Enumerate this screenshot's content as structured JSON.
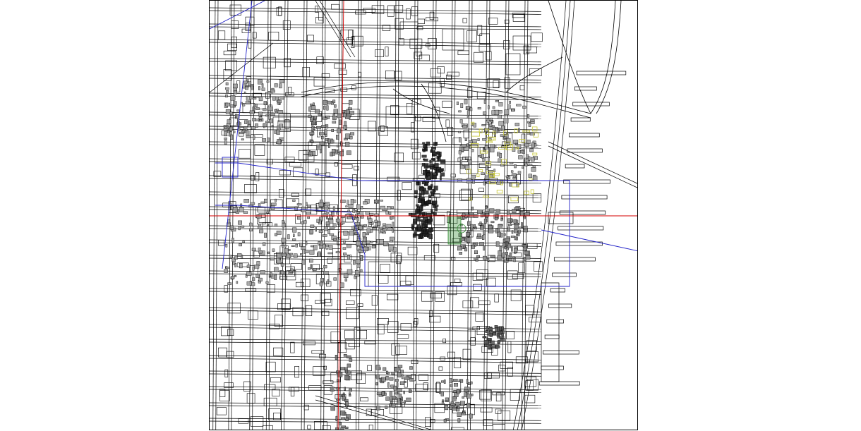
{
  "map": {
    "kind": "city-plan-cad-drawing",
    "colors": {
      "background": "#ffffff",
      "linework": "#000000",
      "crosshair": "#d40000",
      "overlay": "#2323c8",
      "landscape": "#c9c93a",
      "park": "#2f8a2f"
    },
    "layers": [
      "street-grid",
      "building-footprints",
      "highway-interchange",
      "rail-corridor",
      "waterfront-piers",
      "overlay-outline",
      "crosshair"
    ]
  }
}
